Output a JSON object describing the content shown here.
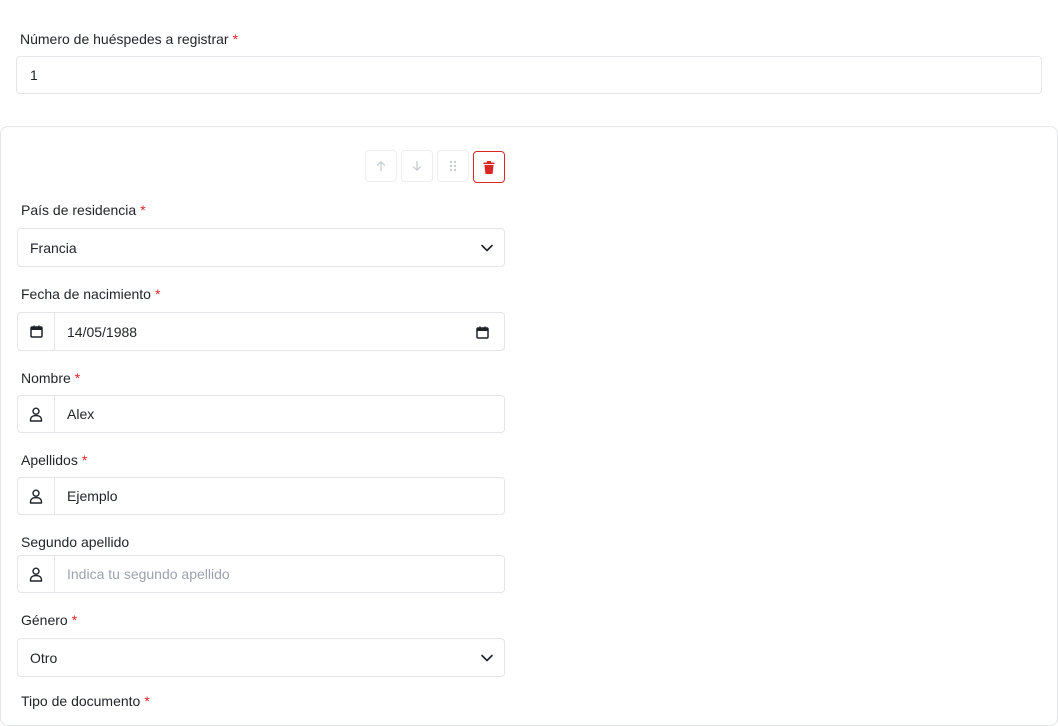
{
  "guests_count": {
    "label": "Número de huéspedes a registrar",
    "required_mark": "*",
    "value": "1"
  },
  "toolbar": {
    "move_up": "arrow-up-icon",
    "move_down": "arrow-down-icon",
    "drag": "drag-handle-icon",
    "delete": "trash-icon"
  },
  "form": {
    "country": {
      "label": "País de residencia",
      "required_mark": "*",
      "value": "Francia"
    },
    "birth_date": {
      "label": "Fecha de nacimiento",
      "required_mark": "*",
      "value": "14/05/1988"
    },
    "first_name": {
      "label": "Nombre",
      "required_mark": "*",
      "value": "Alex"
    },
    "last_name": {
      "label": "Apellidos",
      "required_mark": "*",
      "value": "Ejemplo"
    },
    "second_last_name": {
      "label": "Segundo apellido",
      "placeholder": "Indica tu segundo apellido",
      "value": ""
    },
    "gender": {
      "label": "Género",
      "required_mark": "*",
      "value": "Otro"
    },
    "document_type": {
      "label": "Tipo de documento",
      "required_mark": "*"
    }
  },
  "colors": {
    "required": "#dc2626",
    "border": "#e3e5e8",
    "danger": "#dc2626"
  }
}
